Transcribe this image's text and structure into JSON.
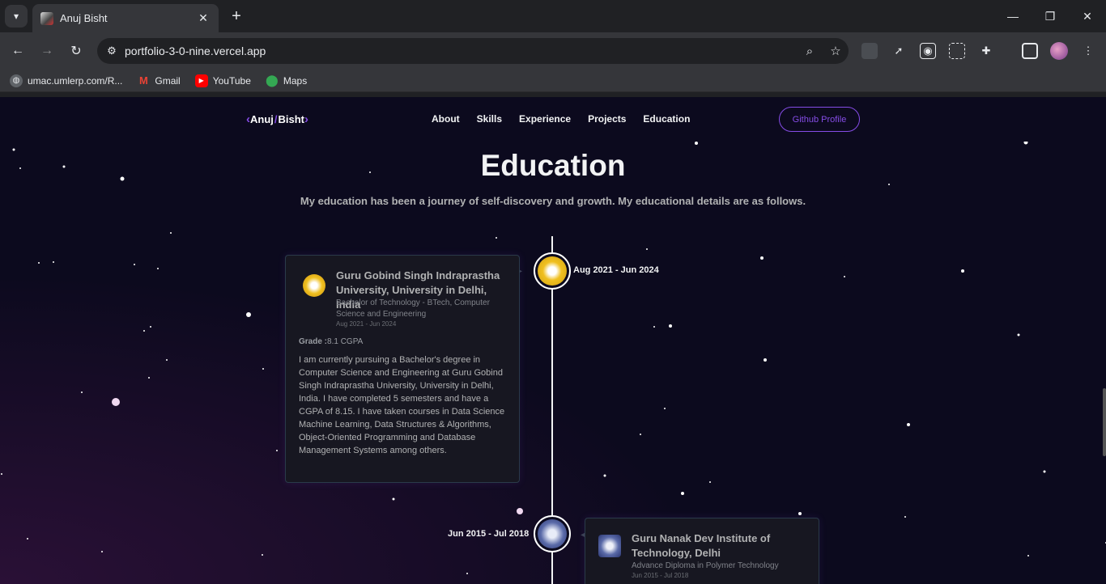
{
  "browser": {
    "tab_title": "Anuj Bisht",
    "url": "portfolio-3-0-nine.vercel.app",
    "bookmarks": [
      {
        "label": "umac.umlerp.com/R...",
        "icon": "globe-icon"
      },
      {
        "label": "Gmail",
        "icon": "gmail-icon"
      },
      {
        "label": "YouTube",
        "icon": "youtube-icon"
      },
      {
        "label": "Maps",
        "icon": "maps-icon"
      }
    ]
  },
  "site": {
    "logo_name": "Anuj",
    "logo_surname": "Bisht",
    "nav": [
      "About",
      "Skills",
      "Experience",
      "Projects",
      "Education"
    ],
    "github_button": "Github Profile",
    "accent": "#854ce6"
  },
  "education": {
    "title": "Education",
    "description": "My education has been a journey of self-discovery and growth. My educational details are as follows.",
    "items": [
      {
        "date": "Aug 2021 - Jun 2024",
        "school": "Guru Gobind Singh Indraprastha University, University in Delhi, India",
        "degree": "Bachelor of Technology - BTech, Computer Science and Engineering",
        "card_date": "Aug 2021 - Jun 2024",
        "grade_label": "Grade :",
        "grade_value": "8.1 CGPA",
        "desc": "I am currently pursuing a Bachelor's degree in Computer Science and Engineering at Guru Gobind Singh Indraprastha University, University in Delhi, India. I have completed 5 semesters and have a CGPA of 8.15. I have taken courses in Data Science Machine Learning, Data Structures & Algorithms, Object-Oriented Programming and Database Management Systems among others."
      },
      {
        "date": "Jun 2015 - Jul 2018",
        "school": "Guru Nanak Dev Institute of Technology, Delhi",
        "degree": "Advance Diploma in Polymer Technology",
        "card_date": "Jun 2015 - Jul 2018"
      }
    ]
  }
}
